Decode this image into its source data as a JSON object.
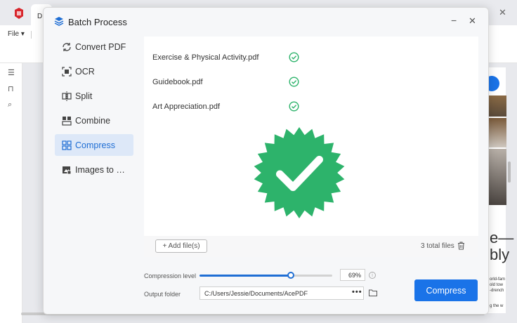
{
  "background_app": {
    "tab_label": "D",
    "menu_file": "File",
    "side_text_big_1": "e—",
    "side_text_big_2": "bly",
    "side_text_small": [
      "orld-fam",
      "old tow",
      "-drench"
    ],
    "side_text_bottom": "g the w"
  },
  "modal": {
    "title": "Batch Process",
    "minimize": "−",
    "close": "✕"
  },
  "nav": {
    "items": [
      {
        "label": "Convert PDF",
        "icon": "convert-icon",
        "active": false
      },
      {
        "label": "OCR",
        "icon": "ocr-icon",
        "active": false
      },
      {
        "label": "Split",
        "icon": "split-icon",
        "active": false
      },
      {
        "label": "Combine",
        "icon": "combine-icon",
        "active": false
      },
      {
        "label": "Compress",
        "icon": "compress-icon",
        "active": true
      },
      {
        "label": "Images to …",
        "icon": "images-icon",
        "active": false
      }
    ]
  },
  "files": [
    {
      "name": "Exercise & Physical Activity.pdf",
      "status": "done"
    },
    {
      "name": "Guidebook.pdf",
      "status": "done"
    },
    {
      "name": "Art Appreciation.pdf",
      "status": "done"
    }
  ],
  "file_footer": {
    "add_files_label": "+ Add file(s)",
    "total_files": "3 total files"
  },
  "options": {
    "compression_label": "Compression level",
    "compression_value": "69%",
    "compression_level": 0.69,
    "output_label": "Output folder",
    "output_path": "C:/Users/Jessie/Documents/AcePDF",
    "browse_dots": "•••"
  },
  "actions": {
    "compress_label": "Compress"
  },
  "colors": {
    "accent": "#1a73e8",
    "success": "#2db36b",
    "active_nav_bg": "#dde8f8"
  }
}
